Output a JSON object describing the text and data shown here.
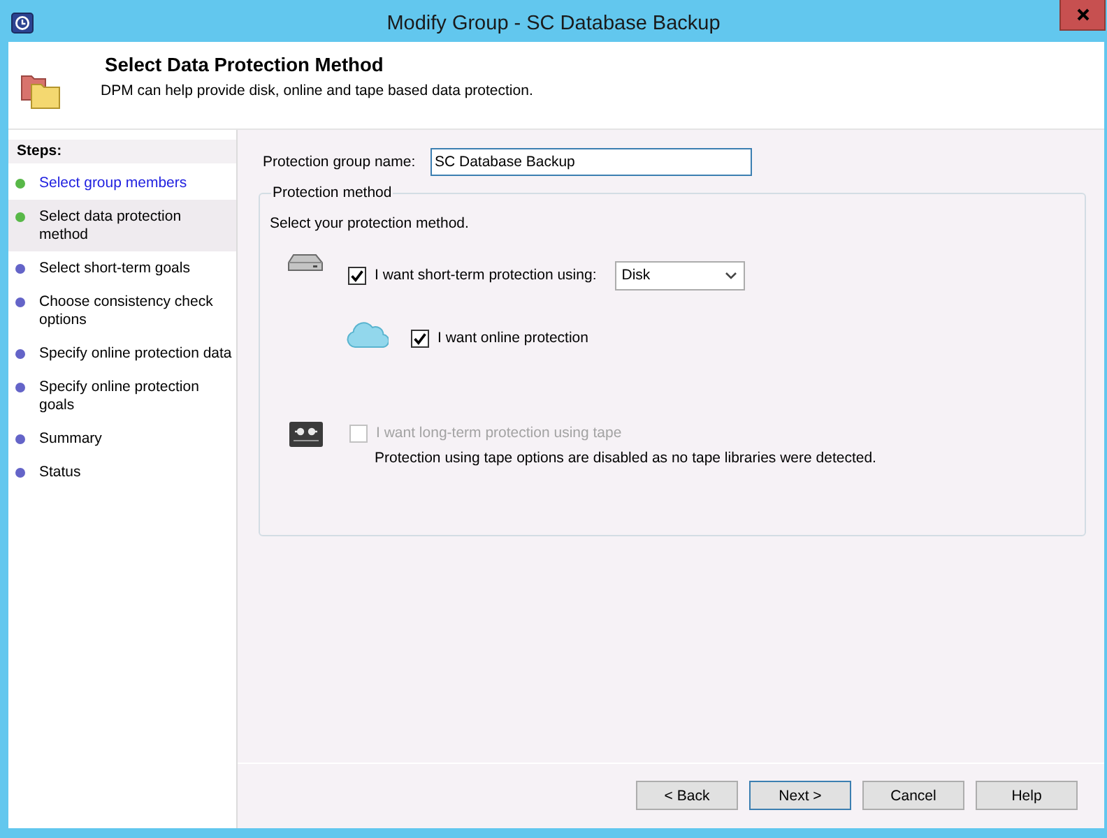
{
  "window": {
    "title": "Modify Group - SC Database Backup"
  },
  "header": {
    "title": "Select Data Protection Method",
    "description": "DPM can help provide disk, online and tape based data protection."
  },
  "steps": {
    "heading": "Steps:",
    "items": [
      {
        "label": "Select group members",
        "color": "#58b848",
        "selected": false,
        "kind": "link"
      },
      {
        "label": "Select data protection method",
        "color": "#58b848",
        "selected": true,
        "kind": "plain"
      },
      {
        "label": "Select short-term goals",
        "color": "#6464c8",
        "selected": false,
        "kind": "plain"
      },
      {
        "label": "Choose consistency check options",
        "color": "#6464c8",
        "selected": false,
        "kind": "plain"
      },
      {
        "label": "Specify online protection data",
        "color": "#6464c8",
        "selected": false,
        "kind": "plain"
      },
      {
        "label": "Specify online protection goals",
        "color": "#6464c8",
        "selected": false,
        "kind": "plain"
      },
      {
        "label": "Summary",
        "color": "#6464c8",
        "selected": false,
        "kind": "plain"
      },
      {
        "label": "Status",
        "color": "#6464c8",
        "selected": false,
        "kind": "plain"
      }
    ]
  },
  "group_name": {
    "label": "Protection group name:",
    "value": "SC Database Backup"
  },
  "protection_method": {
    "legend": "Protection method",
    "instruction": "Select your protection method.",
    "options": [
      {
        "kind": "disk",
        "label": "I want short-term protection using:",
        "checked": true,
        "disabled": false,
        "dropdown": {
          "value": "Disk"
        }
      },
      {
        "kind": "online",
        "label": "I want online protection",
        "checked": true,
        "disabled": false
      },
      {
        "kind": "tape",
        "label": "I want long-term protection using tape",
        "checked": false,
        "disabled": true,
        "note": "Protection using tape options are disabled as no tape libraries were detected."
      }
    ]
  },
  "buttons": [
    {
      "label": "< Back",
      "focused": false
    },
    {
      "label": "Next >",
      "focused": true
    },
    {
      "label": "Cancel",
      "focused": false
    },
    {
      "label": "Help",
      "focused": false
    }
  ]
}
